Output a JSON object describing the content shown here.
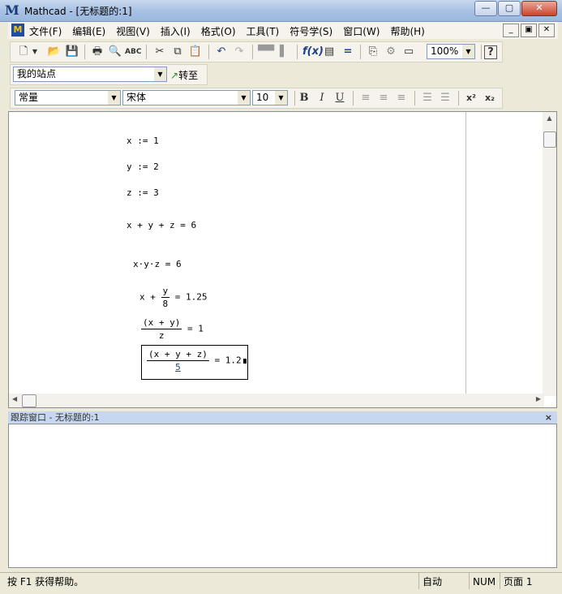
{
  "window": {
    "title": "Mathcad - [无标题的:1]",
    "app_icon": "M"
  },
  "menu": [
    "文件(F)",
    "编辑(E)",
    "视图(V)",
    "插入(I)",
    "格式(O)",
    "工具(T)",
    "符号学(S)",
    "窗口(W)",
    "帮助(H)"
  ],
  "toolbar": {
    "zoom": "100%"
  },
  "website": {
    "value": "我的站点",
    "goto_label": "转至"
  },
  "format": {
    "style": "常量",
    "font": "宋体",
    "size": "10"
  },
  "worksheet": {
    "assign_x": "x := 1",
    "assign_y": "y := 2",
    "assign_z": "z := 3",
    "sum_eval": "x + y + z = 6",
    "prod_eval": "x·y·z = 6",
    "e6_lead": "x +",
    "e6_num": "y",
    "e6_den": "8",
    "e6_result": "= 1.25",
    "e7_num": "(x + y)",
    "e7_den": "z",
    "e7_result": "= 1",
    "e8_num": "(x + y + z)",
    "e8_den": "5",
    "e8_result": "= 1.2"
  },
  "trace_window": {
    "title": "跟踪窗口 - 无标题的:1",
    "close": "×"
  },
  "status": {
    "help": "按 F1 获得帮助。",
    "calc_mode": "自动",
    "num": "NUM",
    "page": "页面 1"
  }
}
